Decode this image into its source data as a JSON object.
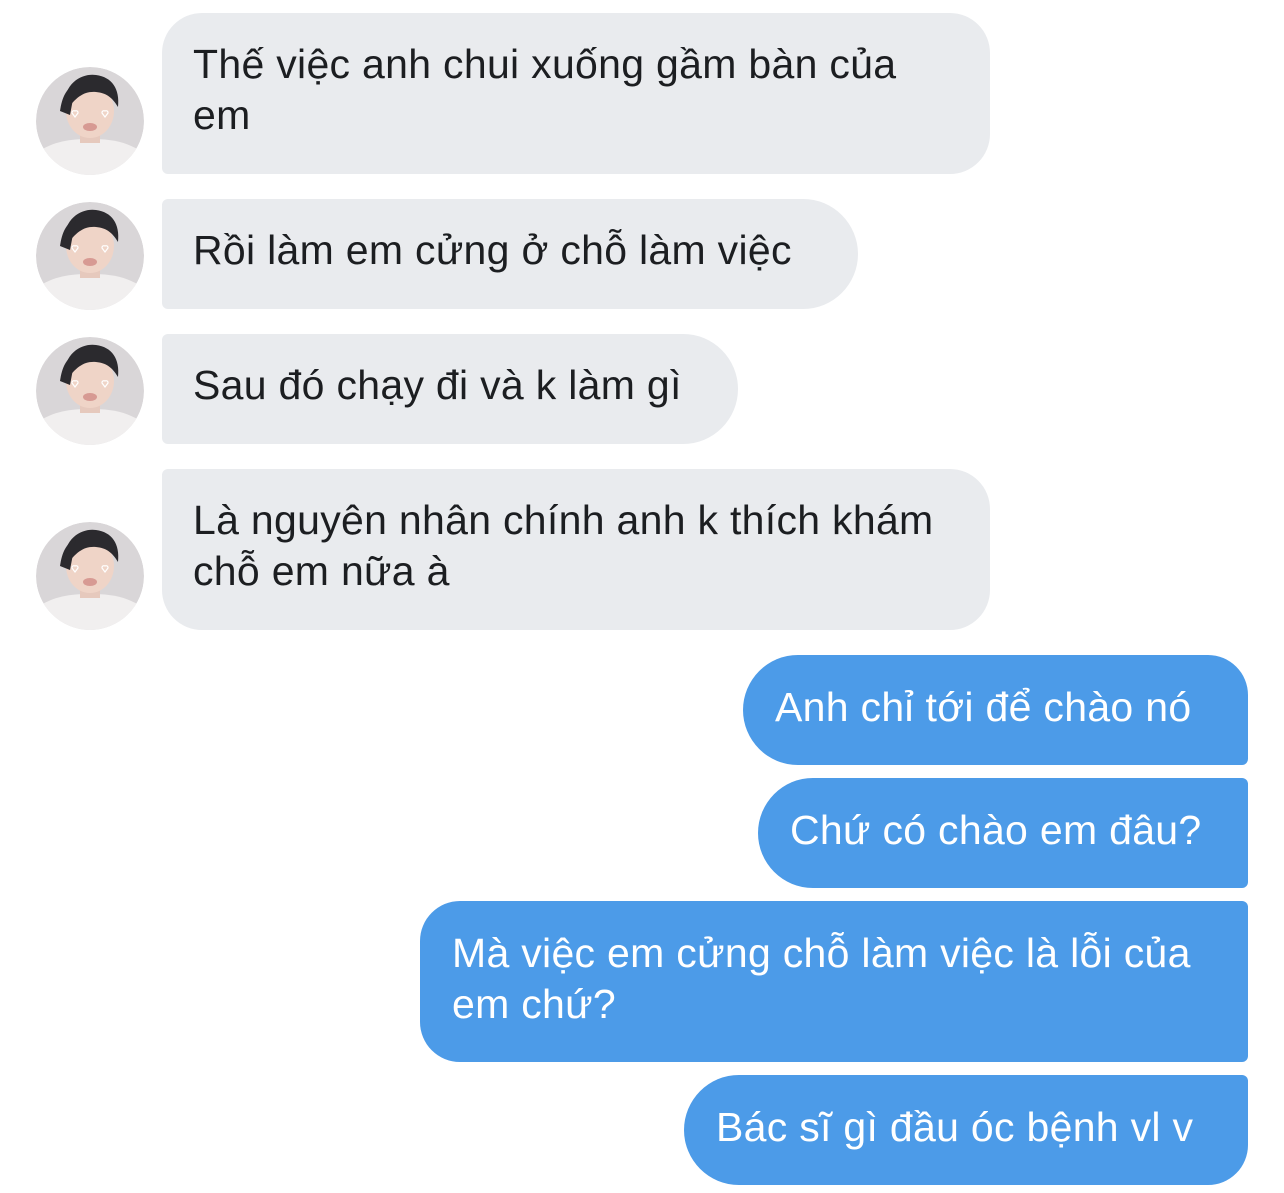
{
  "conversation": {
    "messages": [
      {
        "sender": "contact",
        "text": "Thế việc anh chui xuống gầm bàn của em"
      },
      {
        "sender": "contact",
        "text": "Rồi làm em cửng ở chỗ làm việc"
      },
      {
        "sender": "contact",
        "text": "Sau đó chạy đi và k làm gì"
      },
      {
        "sender": "contact",
        "text": "Là nguyên nhân chính anh k thích khám chỗ em nữa à"
      },
      {
        "sender": "me",
        "text": "Anh chỉ tới để chào nó"
      },
      {
        "sender": "me",
        "text": "Chứ có chào em đâu?"
      },
      {
        "sender": "me",
        "text": "Mà việc em cửng chỗ làm việc là lỗi của em chứ?"
      },
      {
        "sender": "me",
        "text": "Bác sĩ gì đầu óc bệnh vl v"
      }
    ]
  },
  "theme": {
    "incoming_bubble": "#e9ebee",
    "outgoing_bubble": "#4c9be8",
    "background": "#ffffff"
  },
  "icons": {
    "avatar": "contact-avatar-photo"
  }
}
